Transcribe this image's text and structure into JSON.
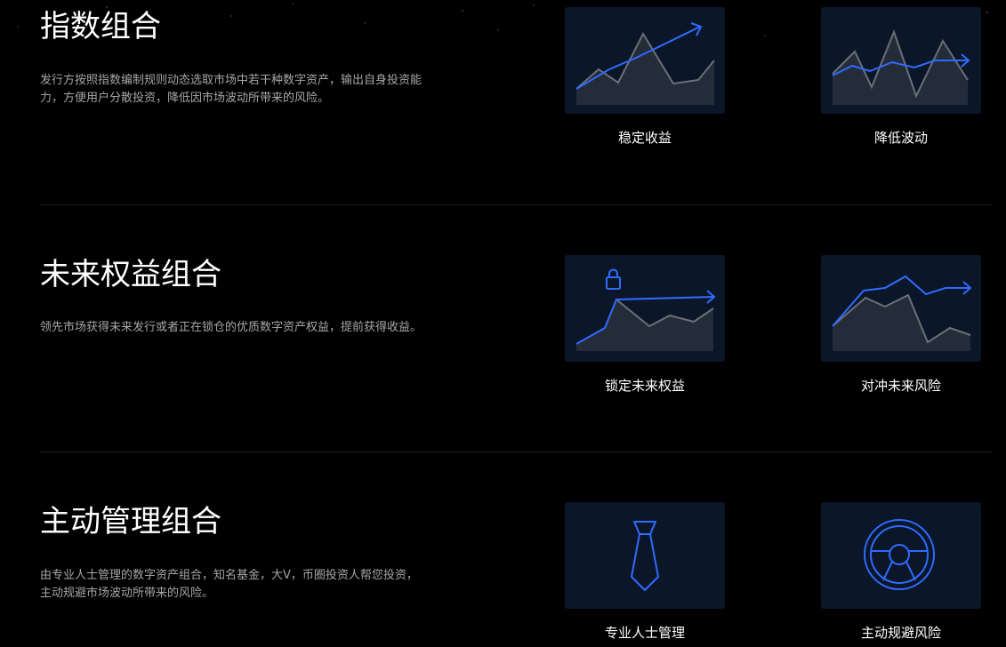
{
  "colors": {
    "background": "#000000",
    "card_bg": "#0b1628",
    "accent_blue": "#2f6bff",
    "gray_line": "#6b6f78",
    "desc_text": "#a6a6a6"
  },
  "sections": [
    {
      "title": "指数组合",
      "description": "发行方按照指数编制规则动态选取市场中若干种数字资产，输出自身投资能力，方便用户分散投资，降低因市场波动所带来的风险。",
      "cards": [
        {
          "label": "稳定收益",
          "icon": "rising-trend-chart-icon"
        },
        {
          "label": "降低波动",
          "icon": "smoothed-volatility-chart-icon"
        }
      ]
    },
    {
      "title": "未来权益组合",
      "description": "领先市场获得未来发行或者正在锁仓的优质数字资产权益，提前获得收益。",
      "cards": [
        {
          "label": "锁定未来权益",
          "icon": "locked-trend-chart-icon"
        },
        {
          "label": "对冲未来风险",
          "icon": "hedge-chart-icon"
        }
      ]
    },
    {
      "title": "主动管理组合",
      "description": "由专业人士管理的数字资产组合，知名基金，大V，币圈投资人帮您投资，主动规避市场波动所带来的风险。",
      "cards": [
        {
          "label": "专业人士管理",
          "icon": "necktie-icon"
        },
        {
          "label": "主动规避风险",
          "icon": "steering-wheel-icon"
        }
      ]
    }
  ]
}
